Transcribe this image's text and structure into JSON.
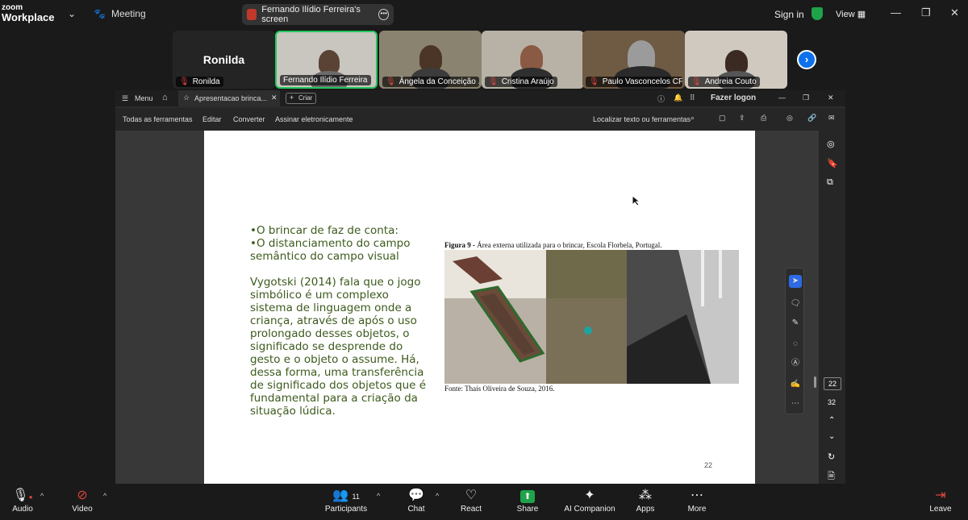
{
  "app": {
    "logo_top": "zoom",
    "logo_bottom": "Workplace",
    "meeting_label": "Meeting",
    "screen_label": "Fernando Ilídio Ferreira's screen",
    "signin": "Sign in",
    "view": "View"
  },
  "participants_strip": [
    {
      "name": "Ronilda",
      "big_name": "Ronilda"
    },
    {
      "name": "Fernando Ilídio Ferreira"
    },
    {
      "name": "Ângela da Conceição ..."
    },
    {
      "name": "Cristina Araújo"
    },
    {
      "name": "Paulo Vasconcelos CFC..."
    },
    {
      "name": "Andreia Couto"
    }
  ],
  "acrobat": {
    "menu": "Menu",
    "tab_title": "Apresentacao brinca...",
    "new_tab": "Criar",
    "login": "Fazer logon",
    "tools": [
      "Todas as ferramentas",
      "Editar",
      "Converter",
      "Assinar eletronicamente"
    ],
    "search": "Localizar texto ou ferramentas",
    "page_current": "22",
    "page_total": "32"
  },
  "slide": {
    "bullet1": "•O brincar de faz de conta:",
    "bullet2": "•O distanciamento do campo semântico do campo visual",
    "paragraph": "Vygotski (2014) fala que o jogo simbólico é um complexo sistema de linguagem onde a criança, através de após o uso prolongado desses objetos, o significado se desprende do gesto e o objeto o assume. Há, dessa forma, uma transferência de significado dos objetos que é fundamental para a criação da situação lúdica.",
    "figure_label": "Figura 9 -",
    "figure_caption": "Área externa utilizada para o brincar, Escola Florbela, Portugal.",
    "figure_source": "Fonte: Thaís Oliveira de Souza, 2016.",
    "page_number": "22"
  },
  "bottom": {
    "audio": "Audio",
    "video": "Video",
    "participants": "Participants",
    "participants_count": "11",
    "chat": "Chat",
    "react": "React",
    "share": "Share",
    "ai": "AI Companion",
    "apps": "Apps",
    "more": "More",
    "leave": "Leave"
  },
  "colors": {
    "accent": "#0e71eb",
    "share": "#1fa34a",
    "slide_text": "#3c5a1c"
  }
}
